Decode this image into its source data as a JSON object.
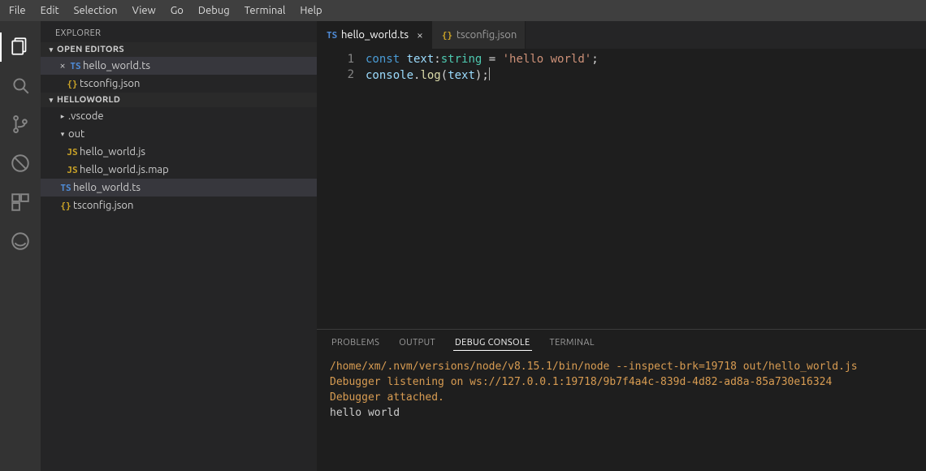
{
  "menubar": [
    "File",
    "Edit",
    "Selection",
    "View",
    "Go",
    "Debug",
    "Terminal",
    "Help"
  ],
  "explorer": {
    "title": "EXPLORER",
    "open_editors": {
      "title": "OPEN EDITORS",
      "items": [
        {
          "icon": "TS",
          "icon_class": "ic-ts",
          "label": "hello_world.ts",
          "dirty_close": "×"
        },
        {
          "icon": "{}",
          "icon_class": "ic-json",
          "label": "tsconfig.json"
        }
      ]
    },
    "workspace": {
      "title": "HELLOWORLD",
      "tree": [
        {
          "type": "folder",
          "expanded": false,
          "label": ".vscode"
        },
        {
          "type": "folder",
          "expanded": true,
          "label": "out"
        },
        {
          "type": "file",
          "indent": 2,
          "icon": "JS",
          "icon_class": "ic-js",
          "label": "hello_world.js"
        },
        {
          "type": "file",
          "indent": 2,
          "icon": "JS",
          "icon_class": "ic-js",
          "label": "hello_world.js.map"
        },
        {
          "type": "file",
          "indent": 1,
          "icon": "TS",
          "icon_class": "ic-ts",
          "label": "hello_world.ts",
          "selected": true
        },
        {
          "type": "file",
          "indent": 1,
          "icon": "{}",
          "icon_class": "ic-json",
          "label": "tsconfig.json"
        }
      ]
    }
  },
  "tabs": [
    {
      "icon": "TS",
      "icon_class": "ic-ts",
      "label": "hello_world.ts",
      "active": true,
      "close": "×"
    },
    {
      "icon": "{}",
      "icon_class": "ic-json",
      "label": "tsconfig.json",
      "active": false
    }
  ],
  "editor": {
    "lines": [
      [
        {
          "t": "const ",
          "c": "tok-kw"
        },
        {
          "t": "text",
          "c": "tok-var"
        },
        {
          "t": ":",
          "c": "tok-pun"
        },
        {
          "t": "string",
          "c": "tok-type"
        },
        {
          "t": " = ",
          "c": "tok-pun"
        },
        {
          "t": "'hello world'",
          "c": "tok-str"
        },
        {
          "t": ";",
          "c": "tok-pun"
        }
      ],
      [
        {
          "t": "console",
          "c": "tok-var"
        },
        {
          "t": ".",
          "c": "tok-pun"
        },
        {
          "t": "log",
          "c": "tok-fn"
        },
        {
          "t": "(",
          "c": "tok-pun"
        },
        {
          "t": "text",
          "c": "tok-var"
        },
        {
          "t": ");",
          "c": "tok-pun"
        }
      ]
    ]
  },
  "panel": {
    "tabs": [
      "PROBLEMS",
      "OUTPUT",
      "DEBUG CONSOLE",
      "TERMINAL"
    ],
    "active": 2,
    "console": {
      "lines": [
        {
          "text": "/home/xm/.nvm/versions/node/v8.15.1/bin/node --inspect-brk=19718 out/hello_world.js",
          "cls": "con-warn"
        },
        {
          "text": "Debugger listening on ws://127.0.0.1:19718/9b7f4a4c-839d-4d82-ad8a-85a730e16324",
          "cls": "con-warn"
        },
        {
          "text": "Debugger attached.",
          "cls": "con-warn"
        },
        {
          "text": "hello world",
          "cls": ""
        }
      ]
    }
  }
}
